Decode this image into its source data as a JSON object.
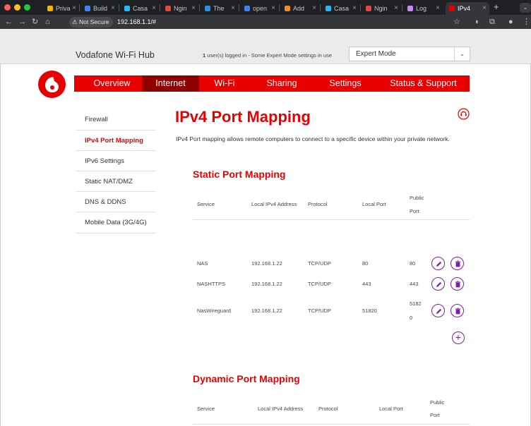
{
  "browser": {
    "traffic_colors": [
      "#ff5f57",
      "#febc2e",
      "#28c840"
    ],
    "tabs": [
      {
        "label": "Priva",
        "color": "#f4b400"
      },
      {
        "label": "Build",
        "color": "#4285f4"
      },
      {
        "label": "Casa",
        "color": "#29b6f6"
      },
      {
        "label": "Ngin",
        "color": "#e5483d"
      },
      {
        "label": "The",
        "color": "#2f8fe0"
      },
      {
        "label": "open",
        "color": "#3b82f6"
      },
      {
        "label": "Add",
        "color": "#f28b24"
      },
      {
        "label": "Casa",
        "color": "#29b6f6"
      },
      {
        "label": "Ngin",
        "color": "#e5483d"
      },
      {
        "label": "Log",
        "color": "#c58af9"
      },
      {
        "label": "IPv4",
        "color": "#e60000"
      }
    ],
    "active_tab_index": 10,
    "security_label": "Not Secure",
    "url": "192.168.1.1/#"
  },
  "header": {
    "brand": "Vodafone Wi-Fi Hub",
    "user_count": "1",
    "users_text": " user(s) logged in - Some Expert Mode settings in use",
    "mode_value": "Expert Mode"
  },
  "nav": {
    "items": [
      "Overview",
      "Internet",
      "Wi-Fi",
      "Sharing",
      "Settings",
      "Status & Support"
    ],
    "active": "Internet"
  },
  "sidebar": {
    "items": [
      "Firewall",
      "IPv4 Port Mapping",
      "IPv6 Settings",
      "Static NAT/DMZ",
      "DNS & DDNS",
      "Mobile Data (3G/4G)"
    ],
    "active": "IPv4 Port Mapping"
  },
  "main": {
    "title": "IPv4 Port Mapping",
    "description": "IPv4 Port mapping allows remote computers to connect to a specific device within your private network.",
    "static_title": "Static Port Mapping",
    "dynamic_title": "Dynamic Port Mapping",
    "columns": {
      "service": "Service",
      "local_ip": "Local IPv4 Address",
      "protocol": "Protocol",
      "local_port": "Local Port",
      "public_port_1": "Public",
      "public_port_2": "Port"
    },
    "rows": [
      {
        "service": "NAS",
        "ip": "192.168.1.22",
        "protocol": "TCP/UDP",
        "local_port": "80",
        "public_port_a": "80",
        "public_port_b": ""
      },
      {
        "service": "NASHTTPS",
        "ip": "192.168.1.22",
        "protocol": "TCP/UDP",
        "local_port": "443",
        "public_port_a": "443",
        "public_port_b": ""
      },
      {
        "service": "NasWireguard",
        "ip": "192.168.1.22",
        "protocol": "TCP/UDP",
        "local_port": "51820",
        "public_port_a": "5182",
        "public_port_b": "0"
      }
    ]
  },
  "colors": {
    "brand_red": "#e60000",
    "nav_active": "#8e0000",
    "action_purple": "#7d1da8"
  }
}
